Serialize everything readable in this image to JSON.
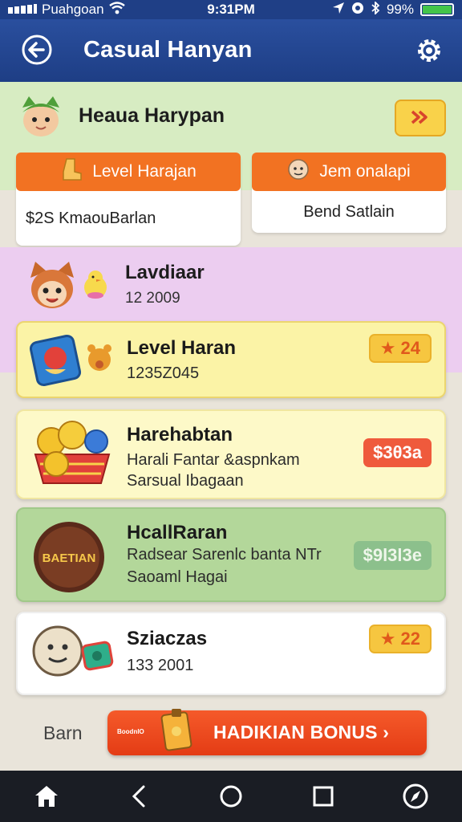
{
  "status_bar": {
    "carrier": "Puahgoan",
    "time": "9:31PM",
    "battery": "99%",
    "battery_level": 0.99
  },
  "app_bar": {
    "title": "Casual Hanyan"
  },
  "profile": {
    "name": "Heaua Harypan"
  },
  "tabs": [
    {
      "label": "Level Harajan",
      "content": "$2S KmaouBarlan"
    },
    {
      "label": "Jem onalapi",
      "content": "Bend Satlain"
    }
  ],
  "level_header": {
    "title": "Lavdiaar",
    "value": "12 2009"
  },
  "cards": [
    {
      "title": "Level Haran",
      "line1": "1235Z045",
      "line2": "",
      "badge": "★ 24",
      "badge_color": "#f5c438"
    },
    {
      "title": "Harehabtan",
      "line1": "Harali Fantar &aspnkam",
      "line2": "Sarsual Ibagaan",
      "badge": "$3θ3a",
      "badge_color": "#ef5a3c"
    },
    {
      "title": "HcallRaran",
      "line1": "Radsear Sarenlc banta NTr",
      "line2": "Saoaml Hagai",
      "badge": "$9l3l3e",
      "badge_color": "#8cc08c"
    },
    {
      "title": "Sziaczas",
      "line1": "133 2001",
      "line2": "",
      "badge": "★ 22",
      "badge_color": "#f5c438"
    }
  ],
  "coin_sign_text": "BAETIAN",
  "bottom": {
    "label": "Barn",
    "bonus_small": "BoodnIO",
    "bonus": "HADIKIAN BONUS ›"
  },
  "nav": [
    "home",
    "back",
    "home-circle",
    "recents",
    "compass"
  ]
}
